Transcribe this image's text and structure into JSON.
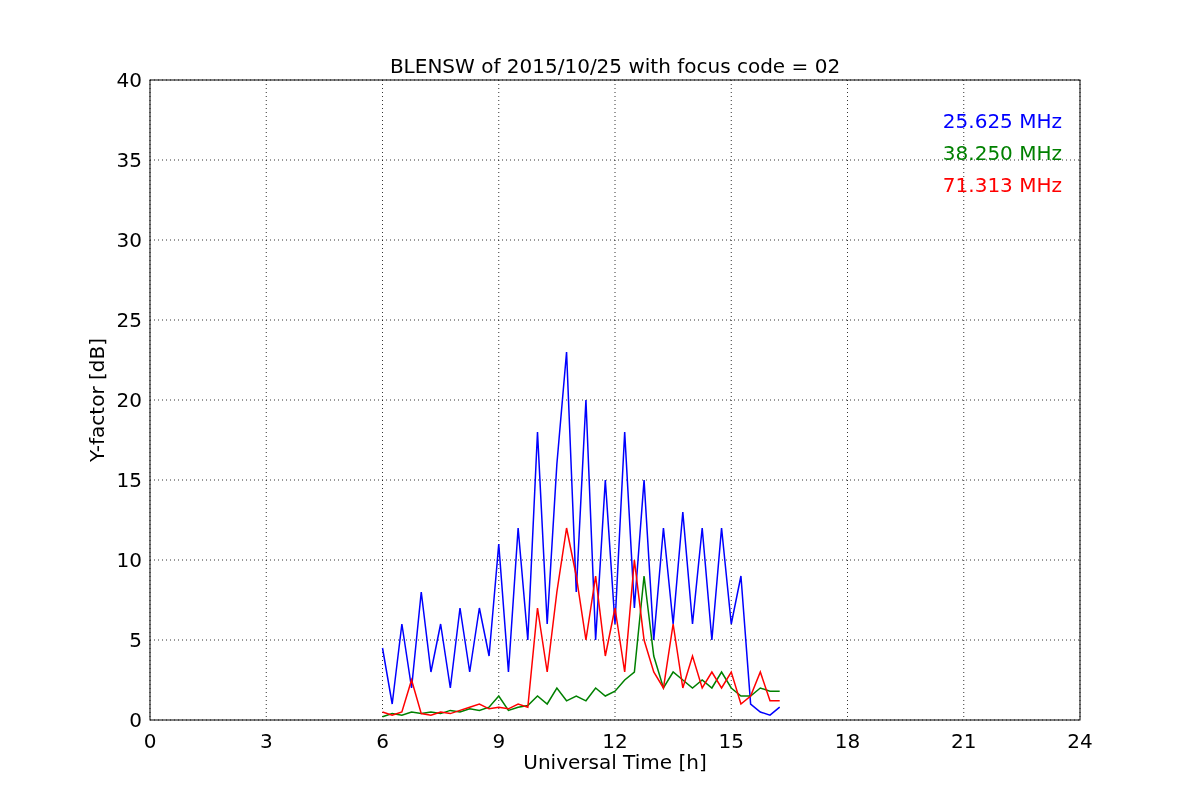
{
  "chart_data": {
    "type": "line",
    "title": "BLENSW of 2015/10/25 with focus code = 02",
    "xlabel": "Universal Time [h]",
    "ylabel": "Y-factor [dB]",
    "xlim": [
      0,
      24
    ],
    "ylim": [
      0,
      40
    ],
    "xticks": [
      0,
      3,
      6,
      9,
      12,
      15,
      18,
      21,
      24
    ],
    "yticks": [
      0,
      5,
      10,
      15,
      20,
      25,
      30,
      35,
      40
    ],
    "grid": true,
    "x": [
      6,
      6.25,
      6.5,
      6.75,
      7,
      7.25,
      7.5,
      7.75,
      8,
      8.25,
      8.5,
      8.75,
      9,
      9.25,
      9.5,
      9.75,
      10,
      10.25,
      10.5,
      10.75,
      11,
      11.25,
      11.5,
      11.75,
      12,
      12.25,
      12.5,
      12.75,
      13,
      13.25,
      13.5,
      13.75,
      14,
      14.25,
      14.5,
      14.75,
      15,
      15.25,
      15.5,
      15.75,
      16,
      16.25
    ],
    "series": [
      {
        "name": "25.625 MHz",
        "color": "#0000ff",
        "values": [
          4.5,
          1,
          6,
          2,
          8,
          3,
          6,
          2,
          7,
          3,
          7,
          4,
          11,
          3,
          12,
          5,
          18,
          6,
          16,
          23,
          8,
          20,
          5,
          15,
          6,
          18,
          7,
          15,
          5,
          12,
          6,
          13,
          6,
          12,
          5,
          12,
          6,
          9,
          1,
          0.5,
          0.3,
          0.8
        ]
      },
      {
        "name": "38.250 MHz",
        "color": "#008000",
        "values": [
          0.2,
          0.4,
          0.3,
          0.5,
          0.4,
          0.5,
          0.4,
          0.6,
          0.5,
          0.7,
          0.6,
          0.8,
          1.5,
          0.6,
          0.8,
          0.9,
          1.5,
          1,
          2,
          1.2,
          1.5,
          1.2,
          2,
          1.5,
          1.8,
          2.5,
          3,
          9,
          4,
          2,
          3,
          2.5,
          2,
          2.5,
          2,
          3,
          2,
          1.5,
          1.5,
          2,
          1.8,
          1.8
        ]
      },
      {
        "name": "71.313 MHz",
        "color": "#ff0000",
        "values": [
          0.5,
          0.3,
          0.5,
          2.5,
          0.4,
          0.3,
          0.5,
          0.4,
          0.6,
          0.8,
          1,
          0.7,
          0.8,
          0.7,
          1,
          0.8,
          7,
          3,
          8,
          12,
          9,
          5,
          9,
          4,
          7,
          3,
          10,
          5,
          3,
          2,
          6,
          2,
          4,
          2,
          3,
          2,
          3,
          1,
          1.5,
          3,
          1.2,
          1.2
        ]
      }
    ]
  }
}
